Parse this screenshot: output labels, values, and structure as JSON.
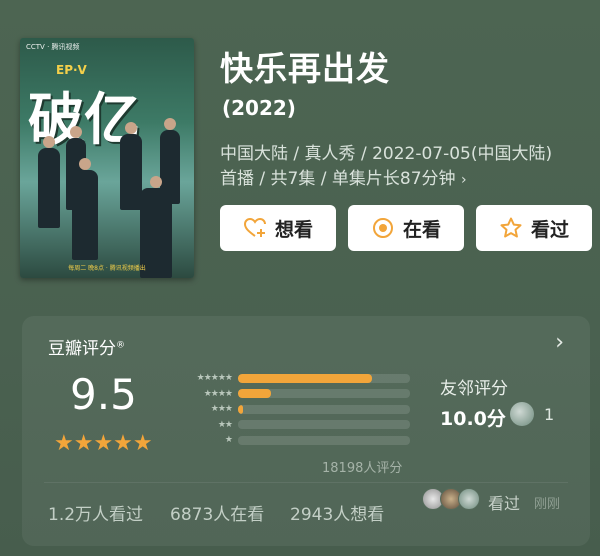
{
  "poster": {
    "logo_text": "CCTV · 腾讯视频",
    "episode_badge": "EP·V",
    "title_art": "破亿",
    "caption": "每周二 晚8点 · 腾讯视频播出"
  },
  "title": "快乐再出发",
  "year": "(2022)",
  "meta": {
    "line1": "中国大陆 / 真人秀 / 2022-07-05(中国大陆)",
    "line2": "首播 / 共7集 / 单集片长87分钟",
    "chevron": "›"
  },
  "buttons": {
    "want": "想看",
    "watching": "在看",
    "watched": "看过"
  },
  "rating": {
    "title": "豆瓣评分",
    "registered_mark": "®",
    "arrow": "›",
    "score": "9.5",
    "stars": "★★★★★",
    "distribution": [
      {
        "stars": "★★★★★",
        "fraction": 0.78
      },
      {
        "stars": "★★★★",
        "fraction": 0.19
      },
      {
        "stars": "★★★",
        "fraction": 0.03
      },
      {
        "stars": "★★",
        "fraction": 0.0
      },
      {
        "stars": "★",
        "fraction": 0.0
      }
    ],
    "count": "18198人评分",
    "friends_title": "友邻评分",
    "friends_score": "10.0分",
    "friends_count": "1"
  },
  "stats": {
    "watched": "1.2万人看过",
    "watching": "6873人在看",
    "want": "2943人想看"
  },
  "activity": {
    "label": "看过",
    "time": "刚刚"
  },
  "colors": {
    "background": "#4a6150",
    "star": "#f2a53a",
    "button_bg": "#ffffff",
    "watching_icon": "#f2a53a"
  }
}
